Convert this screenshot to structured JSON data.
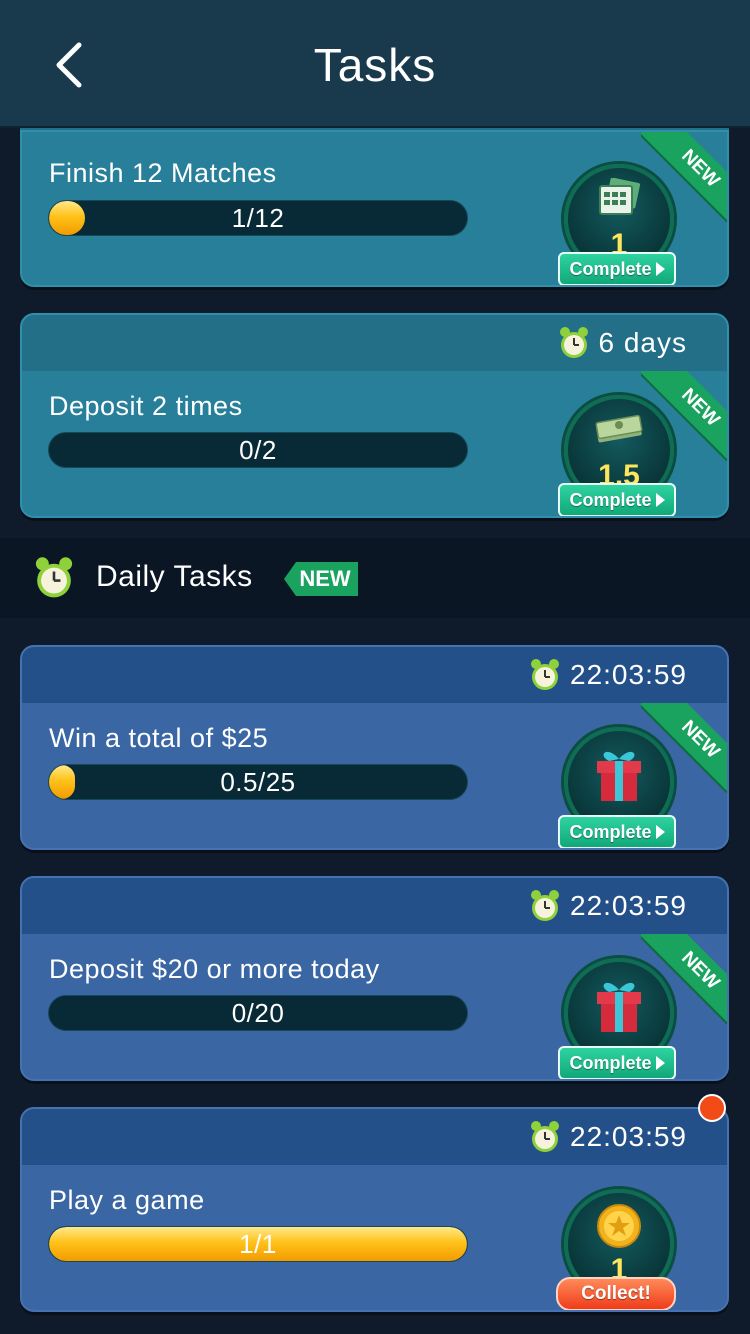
{
  "header": {
    "title": "Tasks",
    "back_icon": "chevron-left-icon"
  },
  "colors": {
    "teal_card": "#287f99",
    "blue_card": "#3a67a4",
    "header": "#183a4c",
    "progress_fill": "#ffc21a",
    "complete_btn": "#12a879",
    "collect_btn": "#ef3c1a"
  },
  "tasks_top": [
    {
      "label": "Finish 12 Matches",
      "progress_text": "1/12",
      "progress": 0.0833,
      "reward_icon": "tickets-icon",
      "reward_qty": "1",
      "button": "Complete",
      "badge": "NEW"
    },
    {
      "timer": "6 days",
      "label": "Deposit 2 times",
      "progress_text": "0/2",
      "progress": 0,
      "reward_icon": "cash-stack-icon",
      "reward_qty": "1.5",
      "button": "Complete",
      "badge": "NEW"
    }
  ],
  "daily_section": {
    "label": "Daily Tasks",
    "badge": "NEW"
  },
  "daily_tasks": [
    {
      "timer": "22:03:59",
      "label": "Win a total of $25",
      "progress_text": "0.5/25",
      "progress": 0.02,
      "reward_icon": "gift-icon",
      "button": "Complete",
      "badge": "NEW"
    },
    {
      "timer": "22:03:59",
      "label": "Deposit $20 or more today",
      "progress_text": "0/20",
      "progress": 0,
      "reward_icon": "gift-icon",
      "button": "Complete",
      "badge": "NEW"
    },
    {
      "timer": "22:03:59",
      "label": "Play a game",
      "progress_text": "1/1",
      "progress": 1,
      "reward_icon": "gold-coin-icon",
      "reward_qty": "1",
      "button": "Collect!"
    }
  ]
}
